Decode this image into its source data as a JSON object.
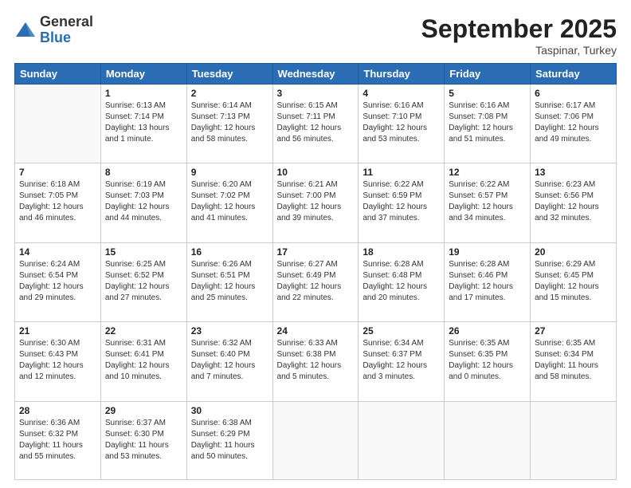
{
  "logo": {
    "general": "General",
    "blue": "Blue"
  },
  "title": {
    "month": "September 2025",
    "location": "Taspinar, Turkey"
  },
  "days_of_week": [
    "Sunday",
    "Monday",
    "Tuesday",
    "Wednesday",
    "Thursday",
    "Friday",
    "Saturday"
  ],
  "weeks": [
    [
      {
        "day": "",
        "info": ""
      },
      {
        "day": "1",
        "info": "Sunrise: 6:13 AM\nSunset: 7:14 PM\nDaylight: 13 hours\nand 1 minute."
      },
      {
        "day": "2",
        "info": "Sunrise: 6:14 AM\nSunset: 7:13 PM\nDaylight: 12 hours\nand 58 minutes."
      },
      {
        "day": "3",
        "info": "Sunrise: 6:15 AM\nSunset: 7:11 PM\nDaylight: 12 hours\nand 56 minutes."
      },
      {
        "day": "4",
        "info": "Sunrise: 6:16 AM\nSunset: 7:10 PM\nDaylight: 12 hours\nand 53 minutes."
      },
      {
        "day": "5",
        "info": "Sunrise: 6:16 AM\nSunset: 7:08 PM\nDaylight: 12 hours\nand 51 minutes."
      },
      {
        "day": "6",
        "info": "Sunrise: 6:17 AM\nSunset: 7:06 PM\nDaylight: 12 hours\nand 49 minutes."
      }
    ],
    [
      {
        "day": "7",
        "info": "Sunrise: 6:18 AM\nSunset: 7:05 PM\nDaylight: 12 hours\nand 46 minutes."
      },
      {
        "day": "8",
        "info": "Sunrise: 6:19 AM\nSunset: 7:03 PM\nDaylight: 12 hours\nand 44 minutes."
      },
      {
        "day": "9",
        "info": "Sunrise: 6:20 AM\nSunset: 7:02 PM\nDaylight: 12 hours\nand 41 minutes."
      },
      {
        "day": "10",
        "info": "Sunrise: 6:21 AM\nSunset: 7:00 PM\nDaylight: 12 hours\nand 39 minutes."
      },
      {
        "day": "11",
        "info": "Sunrise: 6:22 AM\nSunset: 6:59 PM\nDaylight: 12 hours\nand 37 minutes."
      },
      {
        "day": "12",
        "info": "Sunrise: 6:22 AM\nSunset: 6:57 PM\nDaylight: 12 hours\nand 34 minutes."
      },
      {
        "day": "13",
        "info": "Sunrise: 6:23 AM\nSunset: 6:56 PM\nDaylight: 12 hours\nand 32 minutes."
      }
    ],
    [
      {
        "day": "14",
        "info": "Sunrise: 6:24 AM\nSunset: 6:54 PM\nDaylight: 12 hours\nand 29 minutes."
      },
      {
        "day": "15",
        "info": "Sunrise: 6:25 AM\nSunset: 6:52 PM\nDaylight: 12 hours\nand 27 minutes."
      },
      {
        "day": "16",
        "info": "Sunrise: 6:26 AM\nSunset: 6:51 PM\nDaylight: 12 hours\nand 25 minutes."
      },
      {
        "day": "17",
        "info": "Sunrise: 6:27 AM\nSunset: 6:49 PM\nDaylight: 12 hours\nand 22 minutes."
      },
      {
        "day": "18",
        "info": "Sunrise: 6:28 AM\nSunset: 6:48 PM\nDaylight: 12 hours\nand 20 minutes."
      },
      {
        "day": "19",
        "info": "Sunrise: 6:28 AM\nSunset: 6:46 PM\nDaylight: 12 hours\nand 17 minutes."
      },
      {
        "day": "20",
        "info": "Sunrise: 6:29 AM\nSunset: 6:45 PM\nDaylight: 12 hours\nand 15 minutes."
      }
    ],
    [
      {
        "day": "21",
        "info": "Sunrise: 6:30 AM\nSunset: 6:43 PM\nDaylight: 12 hours\nand 12 minutes."
      },
      {
        "day": "22",
        "info": "Sunrise: 6:31 AM\nSunset: 6:41 PM\nDaylight: 12 hours\nand 10 minutes."
      },
      {
        "day": "23",
        "info": "Sunrise: 6:32 AM\nSunset: 6:40 PM\nDaylight: 12 hours\nand 7 minutes."
      },
      {
        "day": "24",
        "info": "Sunrise: 6:33 AM\nSunset: 6:38 PM\nDaylight: 12 hours\nand 5 minutes."
      },
      {
        "day": "25",
        "info": "Sunrise: 6:34 AM\nSunset: 6:37 PM\nDaylight: 12 hours\nand 3 minutes."
      },
      {
        "day": "26",
        "info": "Sunrise: 6:35 AM\nSunset: 6:35 PM\nDaylight: 12 hours\nand 0 minutes."
      },
      {
        "day": "27",
        "info": "Sunrise: 6:35 AM\nSunset: 6:34 PM\nDaylight: 11 hours\nand 58 minutes."
      }
    ],
    [
      {
        "day": "28",
        "info": "Sunrise: 6:36 AM\nSunset: 6:32 PM\nDaylight: 11 hours\nand 55 minutes."
      },
      {
        "day": "29",
        "info": "Sunrise: 6:37 AM\nSunset: 6:30 PM\nDaylight: 11 hours\nand 53 minutes."
      },
      {
        "day": "30",
        "info": "Sunrise: 6:38 AM\nSunset: 6:29 PM\nDaylight: 11 hours\nand 50 minutes."
      },
      {
        "day": "",
        "info": ""
      },
      {
        "day": "",
        "info": ""
      },
      {
        "day": "",
        "info": ""
      },
      {
        "day": "",
        "info": ""
      }
    ]
  ]
}
